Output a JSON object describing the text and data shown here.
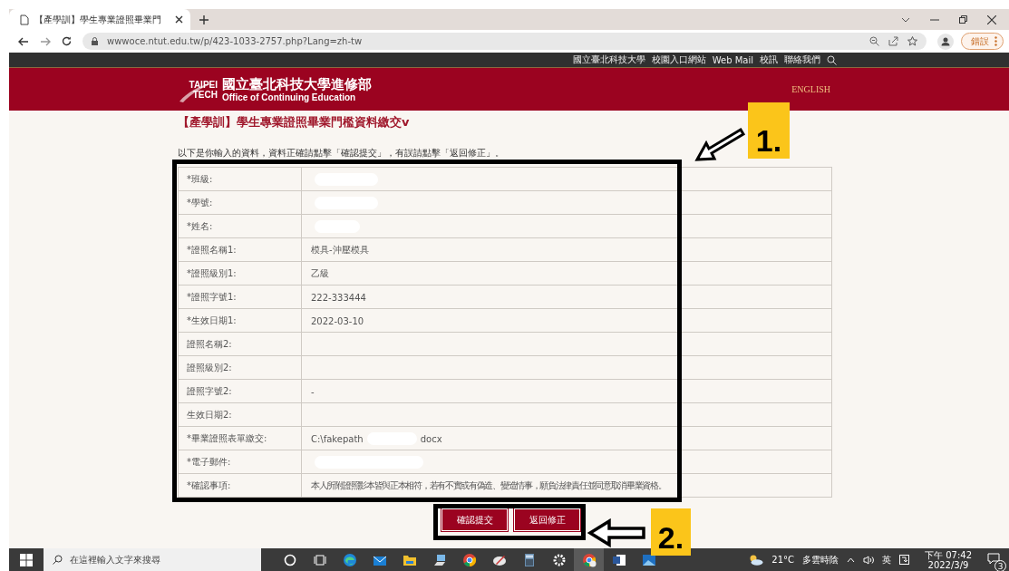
{
  "browser": {
    "tab_title": "【產學訓】學生專業證照畢業門",
    "url": "wwwoce.ntut.edu.tw/p/423-1033-2757.php?Lang=zh-tw",
    "profile_button": "錯誤"
  },
  "top_links": [
    "國立臺北科技大學",
    "校園入口網站",
    "Web Mail",
    "校訊",
    "聯絡我們"
  ],
  "header": {
    "logo_top": "TAIPEI",
    "logo_bottom": "TECH",
    "name": "國立臺北科技大學進修部",
    "english_name": "Office of Continuing Education",
    "language_link": "ENGLISH"
  },
  "page_title": "【產學訓】學生專業證照畢業門檻資料繳交v",
  "intro": "以下是你輸入的資料，資料正確請點擊「確認提交」，有誤請點擊「返回修正」。",
  "rows": [
    {
      "label": "*班級:",
      "redacted": true
    },
    {
      "label": "*學號:",
      "redacted": true
    },
    {
      "label": "*姓名:",
      "redacted": true
    },
    {
      "label": "*證照名稱1:",
      "value": "模具-沖壓模具",
      "redacted": false
    },
    {
      "label": "*證照級別1:",
      "value": "乙級",
      "redacted": false
    },
    {
      "label": "*證照字號1:",
      "value": "222-333444",
      "redacted": false
    },
    {
      "label": "*生效日期1:",
      "value": "2022-03-10",
      "redacted": false
    },
    {
      "label": "證照名稱2:",
      "redacted": false
    },
    {
      "label": "證照級別2:",
      "redacted": false
    },
    {
      "label": "證照字號2:",
      "value": "-",
      "redacted": false
    },
    {
      "label": "生效日期2:",
      "redacted": false
    },
    {
      "label": "*畢業證照表單繳交:",
      "value": "C:\\fakepath",
      "value_after": "docx",
      "redacted": true
    },
    {
      "label": "*電子郵件:",
      "redacted": true
    },
    {
      "label": "*確認事項:",
      "value": "本人所附證照影本皆與正本相符，若有不實或有偽造、變造情事，願負法律責任並同意取消畢業資格。",
      "redacted": false
    }
  ],
  "buttons": [
    "確認提交",
    "返回修正"
  ],
  "annotations": [
    "1.",
    "2."
  ],
  "taskbar": {
    "search_placeholder": "在這裡輸入文字來搜尋",
    "apps": [
      {
        "kind": "cortana",
        "active": false
      },
      {
        "kind": "taskview",
        "active": false
      },
      {
        "kind": "edge",
        "active": false
      },
      {
        "kind": "mail",
        "active": false
      },
      {
        "kind": "folder",
        "active": false
      },
      {
        "kind": "computer",
        "active": false
      },
      {
        "kind": "chrome",
        "active": false
      },
      {
        "kind": "paint",
        "active": false
      },
      {
        "kind": "calculator",
        "active": false
      },
      {
        "kind": "settings",
        "active": false
      },
      {
        "kind": "chrome",
        "active": true
      },
      {
        "kind": "word",
        "active": false
      },
      {
        "kind": "photos",
        "active": false
      }
    ],
    "temperature": "21°C",
    "weather": "多雲時陰",
    "ime": "英",
    "time": "下午 07:42",
    "date": "2022/3/9",
    "notifications": "3"
  }
}
